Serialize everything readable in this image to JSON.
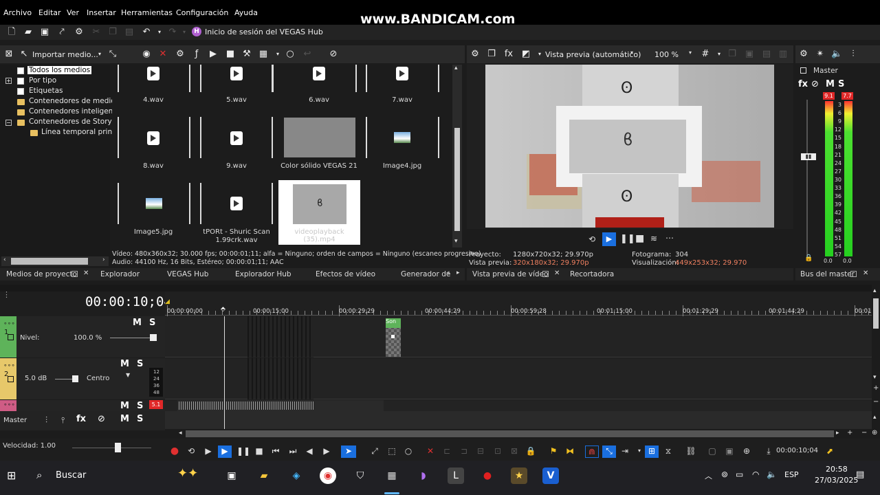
{
  "menu": [
    "Archivo",
    "Editar",
    "Ver",
    "Insertar",
    "Herramientas",
    "Configuración",
    "Ayuda"
  ],
  "watermark": "www.BANDICAM.com",
  "hub_label": "Inicio de sesión del VEGAS Hub",
  "explorer_toolbar": {
    "import": "Importar medio..."
  },
  "tree": [
    "Todos los medios",
    "Por tipo",
    "Etiquetas",
    "Contenedores de medios",
    "Contenedores inteligente",
    "Contenedores de Storybo",
    "Línea temporal princip"
  ],
  "media_items": [
    {
      "label": "4.wav",
      "kind": "audio"
    },
    {
      "label": "5.wav",
      "kind": "audio"
    },
    {
      "label": "6.wav",
      "kind": "audio"
    },
    {
      "label": "7.wav",
      "kind": "audio"
    },
    {
      "label": "8.wav",
      "kind": "audio"
    },
    {
      "label": "9.wav",
      "kind": "audio"
    },
    {
      "label": "Color sólido VEGAS 21",
      "kind": "color"
    },
    {
      "label": "Image4.jpg",
      "kind": "image"
    },
    {
      "label": "Image5.jpg",
      "kind": "image"
    },
    {
      "label": "tPORt - Shuric Scan 1.99crk.wav",
      "kind": "audio"
    },
    {
      "label": "videoplayback (35).mp4",
      "kind": "video"
    }
  ],
  "media_info": {
    "video": "Vídeo: 480x360x32; 30.000 fps; 00:00:01;11; alfa = Ninguno; orden de campos = Ninguno (escaneo progresivo)",
    "audio": "Audio: 44100 Hz, 16 Bits, Estéreo; 00:00:01;11; AAC"
  },
  "left_tabs": [
    "Medios de proyecto",
    "Explorador",
    "VEGAS Hub",
    "Explorador Hub",
    "Efectos de vídeo",
    "Generador de"
  ],
  "preview": {
    "mode": "Vista previa (automático)",
    "zoom": "100 %",
    "proyecto_label": "Proyecto:",
    "proyecto_value": "1280x720x32; 29.970p",
    "vista_label": "Vista previa:",
    "vista_value": "320x180x32; 29.970p",
    "fotograma_label": "Fotograma:",
    "fotograma_value": "304",
    "visual_label": "Visualización:",
    "visual_value": "449x253x32; 29.970",
    "tabs": [
      "Vista previa de vídeo",
      "Recortadora"
    ]
  },
  "master": {
    "title": "Master",
    "peak_l": "9.1",
    "peak_r": "7.7",
    "scale": [
      "3",
      "6",
      "9",
      "12",
      "15",
      "18",
      "21",
      "24",
      "27",
      "30",
      "33",
      "36",
      "39",
      "42",
      "45",
      "48",
      "51",
      "54",
      "57"
    ],
    "bottom_l": "0.0",
    "bottom_r": "0.0",
    "tab": "Bus del master"
  },
  "timeline": {
    "timecode": "00:00:10;04",
    "ruler": [
      "00:00:00;00",
      "00:00:15;00",
      "00:00:29;29",
      "00:00:44;29",
      "00:00:59;28",
      "00:01:15;00",
      "00:01:29;29",
      "00:01:44;29",
      "00:01"
    ],
    "track1": {
      "num": "1",
      "level_label": "Nivel:",
      "level_value": "100.0 %"
    },
    "track2": {
      "num": "2",
      "db": "5.0 dB",
      "pan": "Centro",
      "meter": [
        "12",
        "24",
        "36",
        "48"
      ]
    },
    "track3_peak": "5.1",
    "clip_label": "Son",
    "master_label": "Master",
    "speed": "Velocidad: 1.00",
    "transport_time": "00:00:10;04"
  },
  "taskbar": {
    "search": "Buscar",
    "lang": "ESP",
    "time": "20:58",
    "date": "27/03/2025"
  }
}
